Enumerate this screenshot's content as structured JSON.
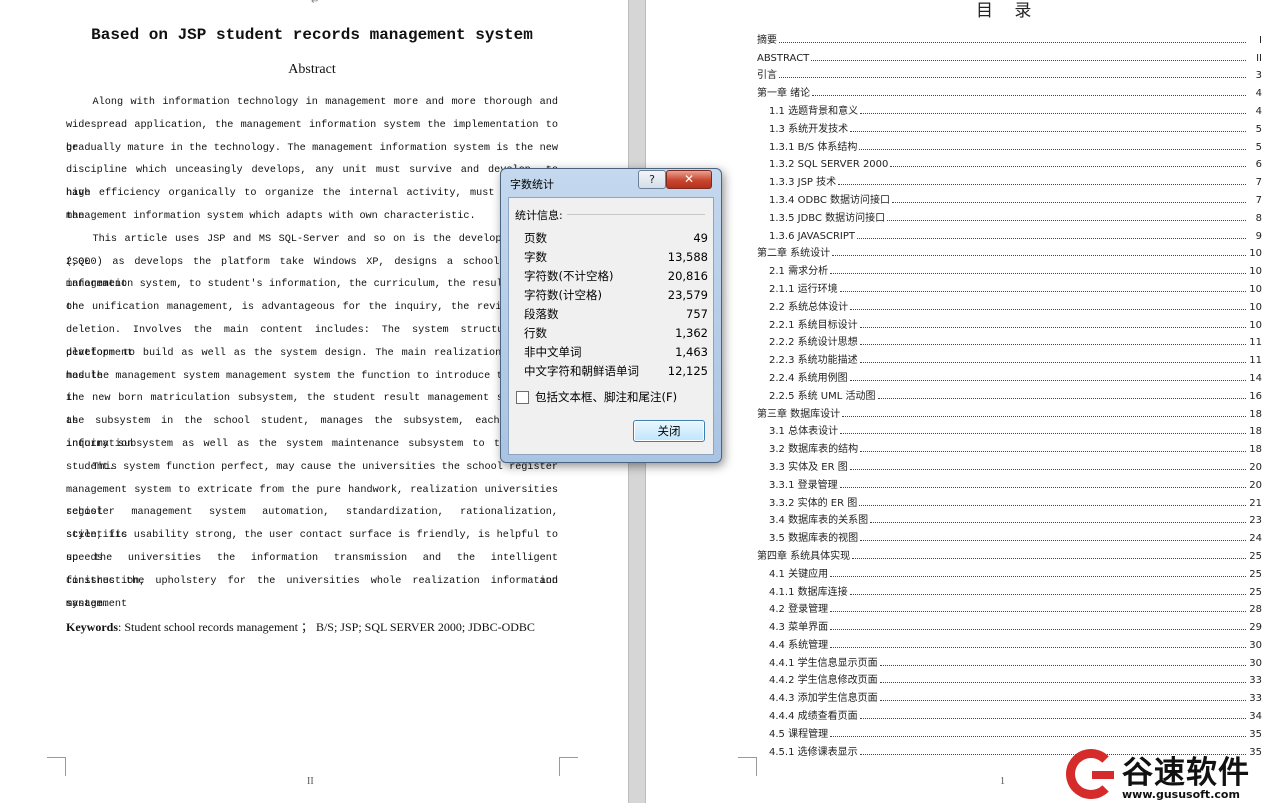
{
  "left_page": {
    "title": "Based on JSP student records management system",
    "abstract_heading": "Abstract",
    "paragraph_lines": [
      "Along with information technology in management more and more thorough and",
      "widespread application, the management information system the implementation to be",
      "gradually mature in the technology. The management information system is the new",
      "discipline which unceasingly develops, any unit must survive and develop, to have the",
      "high efficiency organically to organize the internal activity, must establish the",
      "management information system which adapts with own characteristic.",
      "This article uses JSP and MS SQL-Server and so on is the development kit, (SQL Server",
      "2,000) as develops the platform take Windows XP, designs a school register management",
      "information system, to student's information, the curriculum, the result carries on",
      "the unification management, is advantageous for the inquiry, the revision, the",
      "deletion. Involves the main content includes: The system structure plan, development",
      "platform to build as well as the system design. The main realization function module",
      "has the management system management system the function to introduce the module in",
      "the new born matriculation subsystem, the student result management subsystem, as",
      "the subsystem in the school student, manages the subsystem, each kind of information",
      "inquiry subsystem as well as the system maintenance subsystem to the school student.",
      "This system function perfect, may cause the universities the school register",
      "management system to extricate from the pure handwork, realization universities school",
      "register management system automation, standardization, rationalization, scientific",
      "style, its usability strong, the user contact surface is friendly, is helpful to speeds",
      "up the universities the information transmission and the intelligent construction, and",
      "finishes the upholstery for the universities whole realization information management",
      "system."
    ],
    "keywords_label": "Keywords",
    "keywords_text": ": Student school records management ； B/S; JSP; SQL SERVER 2000; JDBC-ODBC",
    "page_number": "II"
  },
  "right_page": {
    "toc_title": "目 录",
    "toc": [
      {
        "title": "摘要",
        "page": "I"
      },
      {
        "title": "ABSTRACT",
        "page": "II"
      },
      {
        "title": "引言",
        "page": "3"
      },
      {
        "title": "第一章    绪论",
        "page": "4"
      },
      {
        "title": "1.1 选题背景和意义",
        "page": "4"
      },
      {
        "title": "1.3 系统开发技术",
        "page": "5"
      },
      {
        "title": "1.3.1 B/S 体系结构",
        "page": "5"
      },
      {
        "title": "1.3.2 SQL SERVER 2000",
        "page": "6"
      },
      {
        "title": "1.3.3   JSP 技术",
        "page": "7"
      },
      {
        "title": "1.3.4   ODBC 数据访问接口",
        "page": "7"
      },
      {
        "title": "1.3.5 JDBC 数据访问接口",
        "page": "8"
      },
      {
        "title": "1.3.6 JAVASCRIPT",
        "page": "9"
      },
      {
        "title": "第二章  系统设计",
        "page": "10"
      },
      {
        "title": "2.1 需求分析",
        "page": "10"
      },
      {
        "title": "2.1.1 运行环境",
        "page": "10"
      },
      {
        "title": "2.2 系统总体设计",
        "page": "10"
      },
      {
        "title": "2.2.1  系统目标设计",
        "page": "10"
      },
      {
        "title": "2.2.2  系统设计思想",
        "page": "11"
      },
      {
        "title": "2.2.3  系统功能描述",
        "page": "11"
      },
      {
        "title": "2.2.4 系统用例图",
        "page": "14"
      },
      {
        "title": "2.2.5  系统 UML 活动图",
        "page": "16"
      },
      {
        "title": "第三章  数据库设计",
        "page": "18"
      },
      {
        "title": "3.1 总体表设计",
        "page": "18"
      },
      {
        "title": "3.2  数据库表的结构",
        "page": "18"
      },
      {
        "title": "3.3  实体及 ER 图",
        "page": "20"
      },
      {
        "title": "3.3.1  登录管理",
        "page": "20"
      },
      {
        "title": "3.3.2 实体的 ER 图",
        "page": "21"
      },
      {
        "title": "3.4  数据库表的关系图",
        "page": "23"
      },
      {
        "title": "3.5  数据库表的视图",
        "page": "24"
      },
      {
        "title": "第四章  系统具体实现",
        "page": "25"
      },
      {
        "title": "4.1 关键应用",
        "page": "25"
      },
      {
        "title": "4.1.1 数据库连接",
        "page": "25"
      },
      {
        "title": "4.2  登录管理",
        "page": "28"
      },
      {
        "title": "4.3  菜单界面",
        "page": "29"
      },
      {
        "title": "4.4  系统管理",
        "page": "30"
      },
      {
        "title": "4.4.1 学生信息显示页面",
        "page": "30"
      },
      {
        "title": "4.4.2 学生信息修改页面",
        "page": "33"
      },
      {
        "title": "4.4.3 添加学生信息页面",
        "page": "33"
      },
      {
        "title": "4.4.4  成绩查看页面",
        "page": "34"
      },
      {
        "title": "4.5 课程管理",
        "page": "35"
      },
      {
        "title": "4.5.1 选修课表显示",
        "page": "35"
      }
    ],
    "page_number": "1"
  },
  "dialog": {
    "title": "字数统计",
    "help_label": "?",
    "close_x_label": "✕",
    "section_label": "统计信息:",
    "stats": [
      {
        "label": "页数",
        "value": "49"
      },
      {
        "label": "字数",
        "value": "13,588"
      },
      {
        "label": "字符数(不计空格)",
        "value": "20,816"
      },
      {
        "label": "字符数(计空格)",
        "value": "23,579"
      },
      {
        "label": "段落数",
        "value": "757"
      },
      {
        "label": "行数",
        "value": "1,362"
      },
      {
        "label": "非中文单词",
        "value": "1,463"
      },
      {
        "label": "中文字符和朝鲜语单词",
        "value": "12,125"
      }
    ],
    "checkbox_label": "包括文本框、脚注和尾注(F)",
    "checkbox_checked": false,
    "close_button_label": "关闭"
  },
  "watermark": {
    "name": "谷速软件",
    "url": "www.gususoft.com",
    "brand_color": "#d52b2b"
  }
}
